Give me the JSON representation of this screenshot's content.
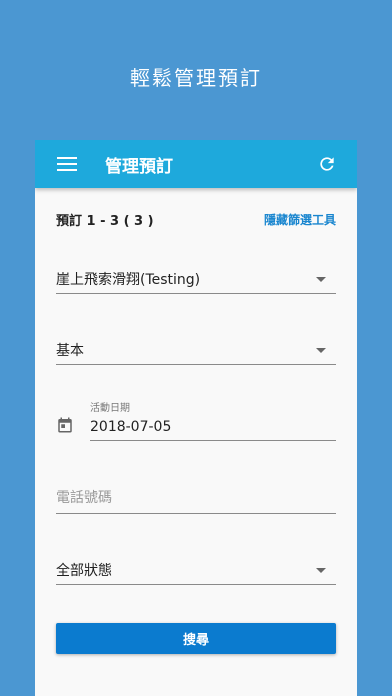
{
  "promo": {
    "headline": "輕鬆管理預訂"
  },
  "appbar": {
    "title": "管理預訂",
    "menu_icon": "menu-icon",
    "refresh_icon": "refresh-icon"
  },
  "summary": {
    "count_text": "預訂 1 - 3 ( 3 )",
    "hide_filter_label": "隱藏篩選工具"
  },
  "filters": {
    "activity": {
      "value": "崖上飛索滑翔(Testing)"
    },
    "package": {
      "value": "基本"
    },
    "date": {
      "label": "活動日期",
      "value": "2018-07-05",
      "icon": "calendar-icon"
    },
    "phone": {
      "placeholder": "電話號碼",
      "value": ""
    },
    "status": {
      "value": "全部狀態"
    }
  },
  "search_button": {
    "label": "搜尋"
  },
  "colors": {
    "background": "#4b97d2",
    "appbar": "#1ea9dc",
    "button": "#0b7bcf",
    "link": "#1a86cf"
  }
}
